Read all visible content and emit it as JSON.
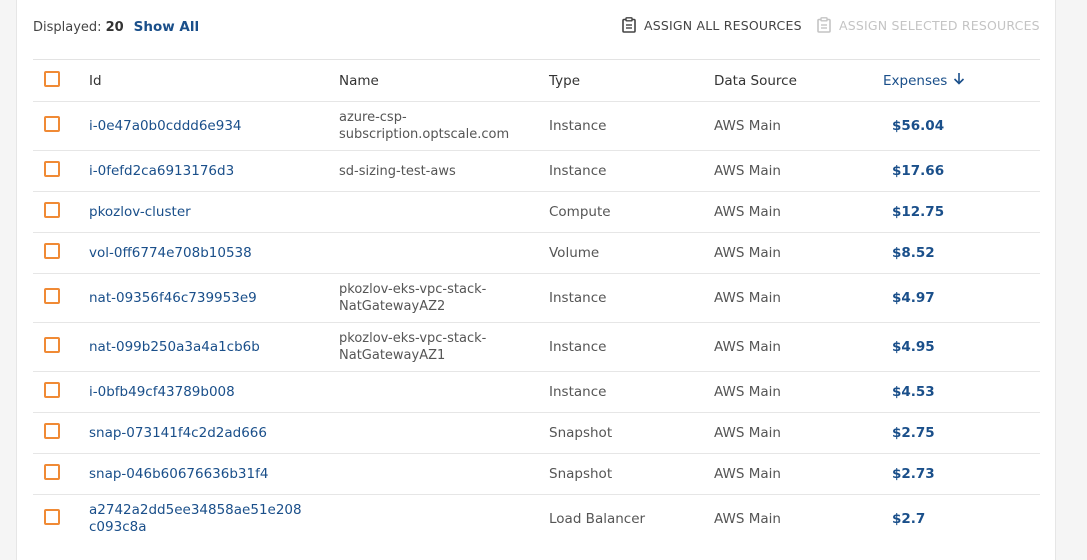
{
  "toolbar": {
    "displayed_label": "Displayed:",
    "displayed_count": "20",
    "show_all": "Show All",
    "assign_all": "ASSIGN ALL RESOURCES",
    "assign_selected": "ASSIGN SELECTED RESOURCES",
    "assign_all_icon": "clipboard-icon",
    "assign_selected_icon": "clipboard-icon"
  },
  "table": {
    "headers": {
      "id": "Id",
      "name": "Name",
      "type": "Type",
      "source": "Data Source",
      "expenses": "Expenses",
      "expenses_sort_icon": "arrow-down-icon"
    },
    "rows": [
      {
        "id": "i-0e47a0b0cddd6e934",
        "name": "azure-csp-subscription.optscale.com",
        "type": "Instance",
        "source": "AWS Main",
        "expenses": "$56.04"
      },
      {
        "id": "i-0fefd2ca6913176d3",
        "name": "sd-sizing-test-aws",
        "type": "Instance",
        "source": "AWS Main",
        "expenses": "$17.66"
      },
      {
        "id": "pkozlov-cluster",
        "name": "",
        "type": "Compute",
        "source": "AWS Main",
        "expenses": "$12.75"
      },
      {
        "id": "vol-0ff6774e708b10538",
        "name": "",
        "type": "Volume",
        "source": "AWS Main",
        "expenses": "$8.52"
      },
      {
        "id": "nat-09356f46c739953e9",
        "name": "pkozlov-eks-vpc-stack-NatGatewayAZ2",
        "type": "Instance",
        "source": "AWS Main",
        "expenses": "$4.97"
      },
      {
        "id": "nat-099b250a3a4a1cb6b",
        "name": "pkozlov-eks-vpc-stack-NatGatewayAZ1",
        "type": "Instance",
        "source": "AWS Main",
        "expenses": "$4.95"
      },
      {
        "id": "i-0bfb49cf43789b008",
        "name": "",
        "type": "Instance",
        "source": "AWS Main",
        "expenses": "$4.53"
      },
      {
        "id": "snap-073141f4c2d2ad666",
        "name": "",
        "type": "Snapshot",
        "source": "AWS Main",
        "expenses": "$2.75"
      },
      {
        "id": "snap-046b60676636b31f4",
        "name": "",
        "type": "Snapshot",
        "source": "AWS Main",
        "expenses": "$2.73"
      },
      {
        "id": "a2742a2dd5ee34858ae51e208c093c8a",
        "name": "",
        "type": "Load Balancer",
        "source": "AWS Main",
        "expenses": "$2.7"
      }
    ]
  },
  "colors": {
    "accent": "#f08a35",
    "link": "#1a4f8a",
    "disabled": "#c4c4c4"
  }
}
